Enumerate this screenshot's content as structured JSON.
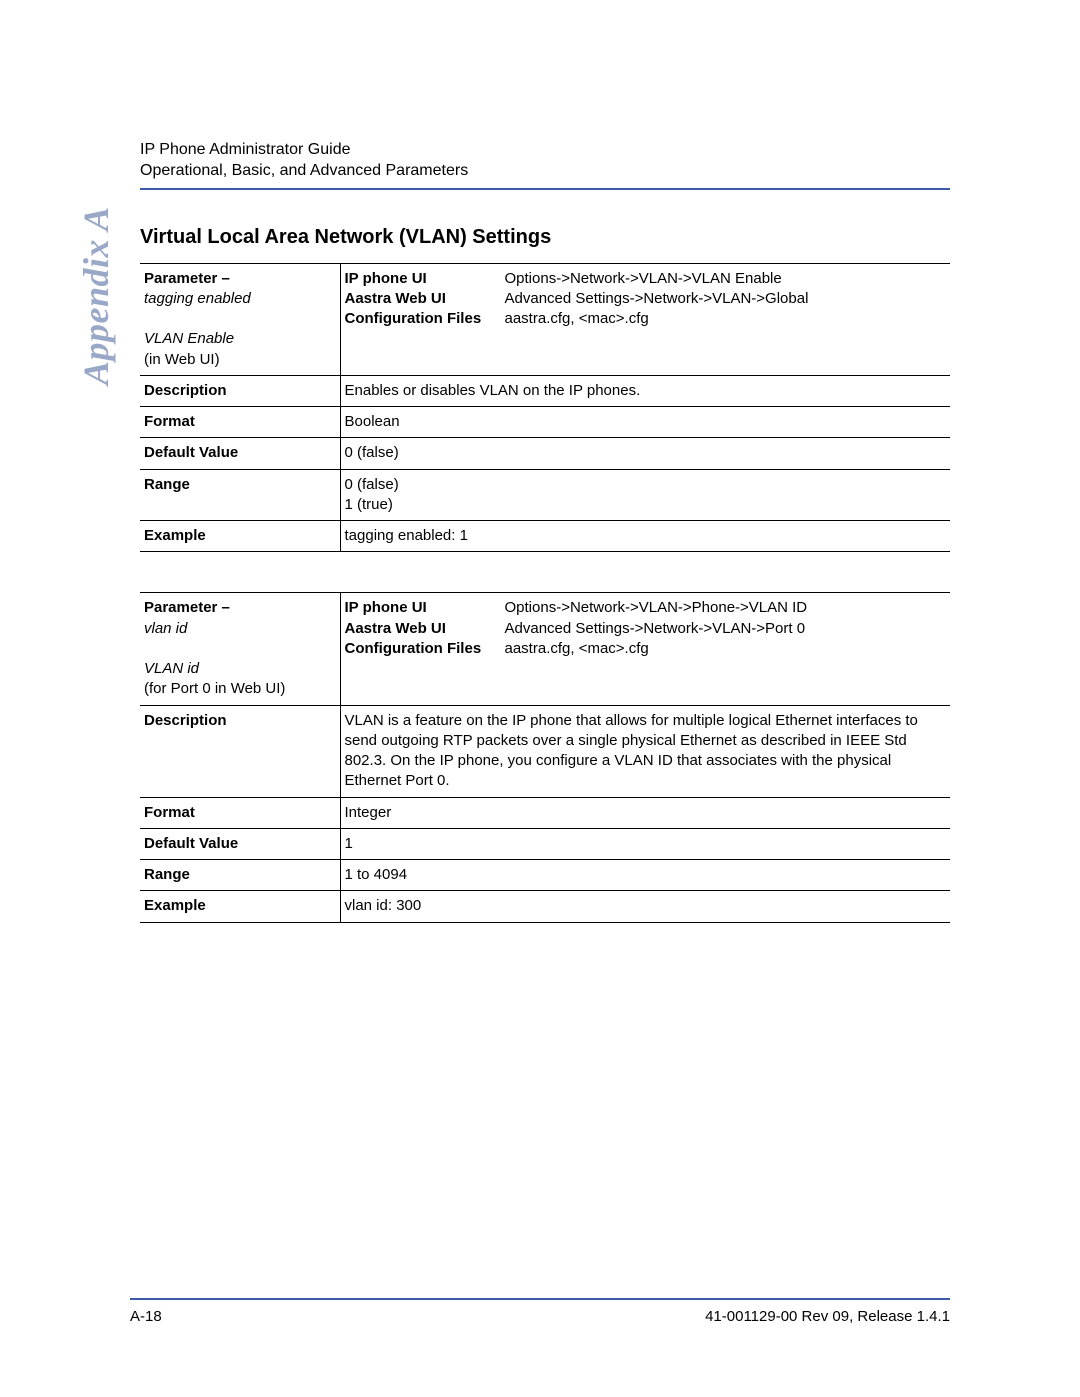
{
  "header": {
    "line1": "IP Phone Administrator Guide",
    "line2": "Operational, Basic, and Advanced Parameters"
  },
  "sideLabel": "Appendix A",
  "sectionTitle": "Virtual Local Area Network (VLAN) Settings",
  "labels": {
    "parameterWord": "Parameter",
    "ipPhoneUI": "IP phone UI",
    "aastraWebUI": "Aastra Web UI",
    "configFiles": "Configuration Files",
    "description": "Description",
    "format": "Format",
    "defaultValue": "Default Value",
    "range": "Range",
    "example": "Example"
  },
  "table1": {
    "paramConfig": "tagging enabled",
    "paramWeb1": "VLAN Enable",
    "paramWeb2": "(in Web UI)",
    "ipPhonePath": "Options->Network->VLAN->VLAN Enable",
    "webPath": "Advanced Settings->Network->VLAN->Global",
    "configFilesVal": "aastra.cfg, <mac>.cfg",
    "description": "Enables or disables VLAN on the IP phones.",
    "format": "Boolean",
    "defaultValue": "0 (false)",
    "rangeLine1": "0 (false)",
    "rangeLine2": "1 (true)",
    "example": "tagging enabled: 1"
  },
  "table2": {
    "paramConfig": "vlan id",
    "paramWeb1": "VLAN id",
    "paramWeb2": "(for Port 0 in Web UI)",
    "ipPhonePath": "Options->Network->VLAN->Phone->VLAN ID",
    "webPath": "Advanced Settings->Network->VLAN->Port 0",
    "configFilesVal": "aastra.cfg, <mac>.cfg",
    "description": "VLAN is a feature on the IP phone that allows for multiple logical Ethernet interfaces to send outgoing RTP packets over a single physical Ethernet as described in IEEE Std 802.3. On the IP phone, you configure a VLAN ID that associates with the physical Ethernet Port 0.",
    "format": "Integer",
    "defaultValue": "1",
    "range": "1 to 4094",
    "example": "vlan id: 300"
  },
  "footer": {
    "pageNum": "A-18",
    "docRef": "41-001129-00 Rev 09, Release 1.4.1"
  }
}
